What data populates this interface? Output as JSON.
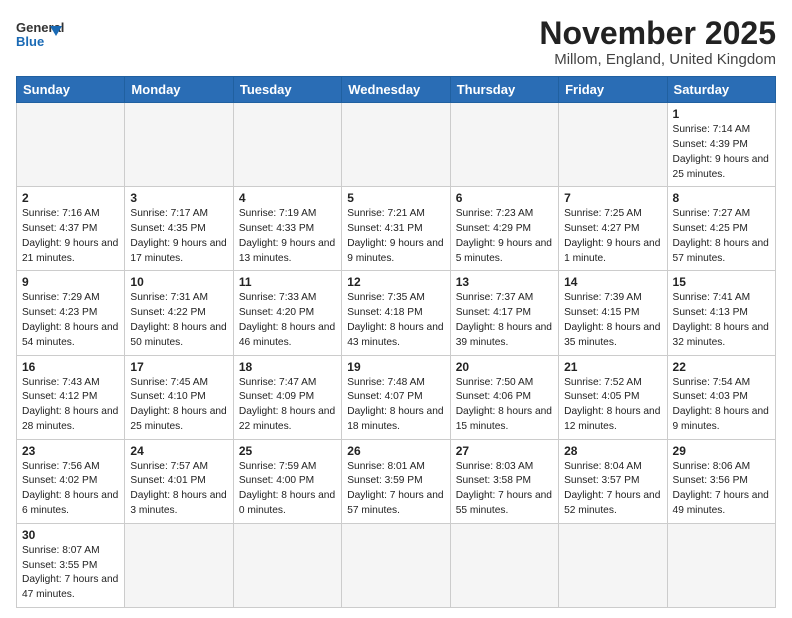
{
  "header": {
    "logo_general": "General",
    "logo_blue": "Blue",
    "month_title": "November 2025",
    "subtitle": "Millom, England, United Kingdom"
  },
  "days_of_week": [
    "Sunday",
    "Monday",
    "Tuesday",
    "Wednesday",
    "Thursday",
    "Friday",
    "Saturday"
  ],
  "weeks": [
    [
      {
        "day": "",
        "info": ""
      },
      {
        "day": "",
        "info": ""
      },
      {
        "day": "",
        "info": ""
      },
      {
        "day": "",
        "info": ""
      },
      {
        "day": "",
        "info": ""
      },
      {
        "day": "",
        "info": ""
      },
      {
        "day": "1",
        "info": "Sunrise: 7:14 AM\nSunset: 4:39 PM\nDaylight: 9 hours\nand 25 minutes."
      }
    ],
    [
      {
        "day": "2",
        "info": "Sunrise: 7:16 AM\nSunset: 4:37 PM\nDaylight: 9 hours\nand 21 minutes."
      },
      {
        "day": "3",
        "info": "Sunrise: 7:17 AM\nSunset: 4:35 PM\nDaylight: 9 hours\nand 17 minutes."
      },
      {
        "day": "4",
        "info": "Sunrise: 7:19 AM\nSunset: 4:33 PM\nDaylight: 9 hours\nand 13 minutes."
      },
      {
        "day": "5",
        "info": "Sunrise: 7:21 AM\nSunset: 4:31 PM\nDaylight: 9 hours\nand 9 minutes."
      },
      {
        "day": "6",
        "info": "Sunrise: 7:23 AM\nSunset: 4:29 PM\nDaylight: 9 hours\nand 5 minutes."
      },
      {
        "day": "7",
        "info": "Sunrise: 7:25 AM\nSunset: 4:27 PM\nDaylight: 9 hours\nand 1 minute."
      },
      {
        "day": "8",
        "info": "Sunrise: 7:27 AM\nSunset: 4:25 PM\nDaylight: 8 hours\nand 57 minutes."
      }
    ],
    [
      {
        "day": "9",
        "info": "Sunrise: 7:29 AM\nSunset: 4:23 PM\nDaylight: 8 hours\nand 54 minutes."
      },
      {
        "day": "10",
        "info": "Sunrise: 7:31 AM\nSunset: 4:22 PM\nDaylight: 8 hours\nand 50 minutes."
      },
      {
        "day": "11",
        "info": "Sunrise: 7:33 AM\nSunset: 4:20 PM\nDaylight: 8 hours\nand 46 minutes."
      },
      {
        "day": "12",
        "info": "Sunrise: 7:35 AM\nSunset: 4:18 PM\nDaylight: 8 hours\nand 43 minutes."
      },
      {
        "day": "13",
        "info": "Sunrise: 7:37 AM\nSunset: 4:17 PM\nDaylight: 8 hours\nand 39 minutes."
      },
      {
        "day": "14",
        "info": "Sunrise: 7:39 AM\nSunset: 4:15 PM\nDaylight: 8 hours\nand 35 minutes."
      },
      {
        "day": "15",
        "info": "Sunrise: 7:41 AM\nSunset: 4:13 PM\nDaylight: 8 hours\nand 32 minutes."
      }
    ],
    [
      {
        "day": "16",
        "info": "Sunrise: 7:43 AM\nSunset: 4:12 PM\nDaylight: 8 hours\nand 28 minutes."
      },
      {
        "day": "17",
        "info": "Sunrise: 7:45 AM\nSunset: 4:10 PM\nDaylight: 8 hours\nand 25 minutes."
      },
      {
        "day": "18",
        "info": "Sunrise: 7:47 AM\nSunset: 4:09 PM\nDaylight: 8 hours\nand 22 minutes."
      },
      {
        "day": "19",
        "info": "Sunrise: 7:48 AM\nSunset: 4:07 PM\nDaylight: 8 hours\nand 18 minutes."
      },
      {
        "day": "20",
        "info": "Sunrise: 7:50 AM\nSunset: 4:06 PM\nDaylight: 8 hours\nand 15 minutes."
      },
      {
        "day": "21",
        "info": "Sunrise: 7:52 AM\nSunset: 4:05 PM\nDaylight: 8 hours\nand 12 minutes."
      },
      {
        "day": "22",
        "info": "Sunrise: 7:54 AM\nSunset: 4:03 PM\nDaylight: 8 hours\nand 9 minutes."
      }
    ],
    [
      {
        "day": "23",
        "info": "Sunrise: 7:56 AM\nSunset: 4:02 PM\nDaylight: 8 hours\nand 6 minutes."
      },
      {
        "day": "24",
        "info": "Sunrise: 7:57 AM\nSunset: 4:01 PM\nDaylight: 8 hours\nand 3 minutes."
      },
      {
        "day": "25",
        "info": "Sunrise: 7:59 AM\nSunset: 4:00 PM\nDaylight: 8 hours\nand 0 minutes."
      },
      {
        "day": "26",
        "info": "Sunrise: 8:01 AM\nSunset: 3:59 PM\nDaylight: 7 hours\nand 57 minutes."
      },
      {
        "day": "27",
        "info": "Sunrise: 8:03 AM\nSunset: 3:58 PM\nDaylight: 7 hours\nand 55 minutes."
      },
      {
        "day": "28",
        "info": "Sunrise: 8:04 AM\nSunset: 3:57 PM\nDaylight: 7 hours\nand 52 minutes."
      },
      {
        "day": "29",
        "info": "Sunrise: 8:06 AM\nSunset: 3:56 PM\nDaylight: 7 hours\nand 49 minutes."
      }
    ],
    [
      {
        "day": "30",
        "info": "Sunrise: 8:07 AM\nSunset: 3:55 PM\nDaylight: 7 hours\nand 47 minutes."
      },
      {
        "day": "",
        "info": ""
      },
      {
        "day": "",
        "info": ""
      },
      {
        "day": "",
        "info": ""
      },
      {
        "day": "",
        "info": ""
      },
      {
        "day": "",
        "info": ""
      },
      {
        "day": "",
        "info": ""
      }
    ]
  ]
}
